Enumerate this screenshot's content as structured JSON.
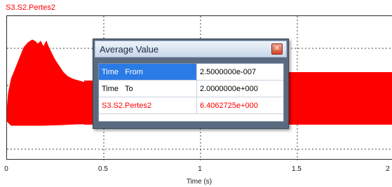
{
  "plot": {
    "trace_title": "S3.S2.Pertes2",
    "x_ticks": [
      "0",
      "0.5",
      "1",
      "1.5",
      "2"
    ],
    "x_label": "Time (s)",
    "trace_color": "#ff0000"
  },
  "dialog": {
    "title": "Average Value",
    "rows": [
      {
        "label": "Time   From",
        "value": "2.5000000e-007"
      },
      {
        "label": "Time   To",
        "value": "2.0000000e+000"
      },
      {
        "label": "S3.S2.Pertes2",
        "value": "6.4062725e+000"
      }
    ]
  },
  "chart_data": {
    "type": "area",
    "series": [
      {
        "name": "S3.S2.Pertes2",
        "color": "#ff0000"
      }
    ],
    "xlim": [
      0,
      2
    ],
    "x_ticks": [
      0,
      0.5,
      1,
      1.5,
      2
    ],
    "xlabel": "Time (s)",
    "grid": true
  }
}
